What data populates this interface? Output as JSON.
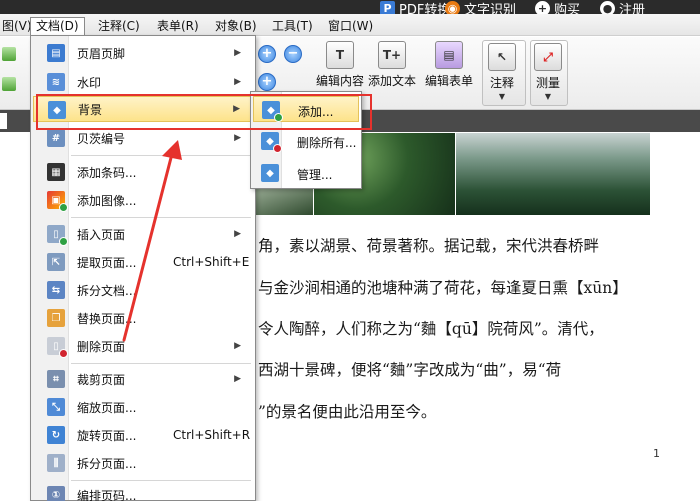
{
  "titlebar": {
    "items": [
      {
        "icon": "pdf-convert-icon",
        "label": "PDF转换"
      },
      {
        "icon": "ocr-eye-icon",
        "label": "文字识别"
      },
      {
        "icon": "plus-icon",
        "label": "购买"
      },
      {
        "icon": "user-icon",
        "label": "注册"
      }
    ]
  },
  "menubar": {
    "items": [
      {
        "label": "图(V)"
      },
      {
        "label": "文档(D)"
      },
      {
        "label": "注释(C)"
      },
      {
        "label": "表单(R)"
      },
      {
        "label": "对象(B)"
      },
      {
        "label": "工具(T)"
      },
      {
        "label": "窗口(W)"
      }
    ]
  },
  "ribbon": {
    "edit_content": "编辑内容",
    "add_text": "添加文本",
    "edit_form": "编辑表单",
    "annotate": "注释",
    "measure": "测量"
  },
  "doc_menu": {
    "items": [
      {
        "label": "页眉页脚",
        "shortcut": "",
        "submenu": true
      },
      {
        "label": "水印",
        "shortcut": "",
        "submenu": true
      },
      {
        "label": "背景",
        "shortcut": "",
        "submenu": true
      },
      {
        "label": "贝茨编号",
        "shortcut": "",
        "submenu": true
      },
      {
        "label": "添加条码...",
        "shortcut": "",
        "submenu": false
      },
      {
        "label": "添加图像...",
        "shortcut": "",
        "submenu": false
      },
      {
        "label": "插入页面",
        "shortcut": "",
        "submenu": true
      },
      {
        "label": "提取页面...",
        "shortcut": "Ctrl+Shift+E",
        "submenu": false
      },
      {
        "label": "拆分文档...",
        "shortcut": "",
        "submenu": false
      },
      {
        "label": "替换页面...",
        "shortcut": "",
        "submenu": false
      },
      {
        "label": "删除页面",
        "shortcut": "",
        "submenu": true
      },
      {
        "label": "裁剪页面",
        "shortcut": "",
        "submenu": true
      },
      {
        "label": "缩放页面...",
        "shortcut": "",
        "submenu": false
      },
      {
        "label": "旋转页面...",
        "shortcut": "Ctrl+Shift+R",
        "submenu": false
      },
      {
        "label": "拆分页面...",
        "shortcut": "",
        "submenu": false
      },
      {
        "label": "编排页码...",
        "shortcut": "",
        "submenu": false
      }
    ]
  },
  "background_submenu": {
    "items": [
      {
        "label": "添加..."
      },
      {
        "label": "删除所有..."
      },
      {
        "label": "管理..."
      }
    ]
  },
  "document": {
    "lines": [
      "角，素以湖景、荷景著称。据记载，宋代洪春桥畔",
      "与金沙涧相通的池塘种满了荷花，每逢夏日熏【xūn】",
      "令人陶醉，人们称之为“麯【qū】院荷风”。清代，",
      "西湖十景碑，便将“麯”字改成为“曲”，易“荷",
      "”的景名便由此沿用至今。"
    ],
    "page_number": "1"
  },
  "colors": {
    "highlight_box": "#e5322d",
    "arrow": "#e5322d",
    "menu_highlight": "#fde38a"
  }
}
